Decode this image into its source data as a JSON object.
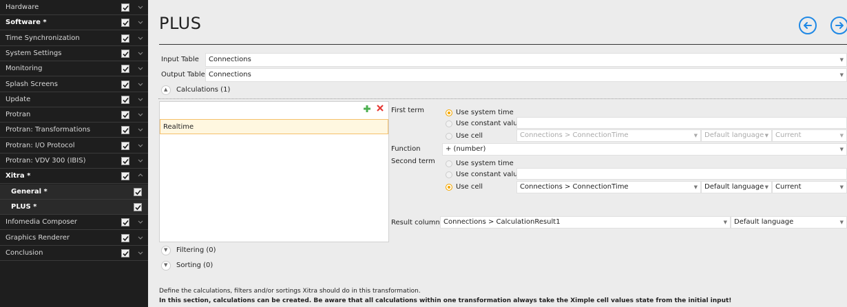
{
  "sidebar": {
    "items": [
      {
        "label": "Hardware",
        "checked": true
      },
      {
        "label": "Software *",
        "checked": true
      },
      {
        "label": "Time Synchronization",
        "checked": true
      },
      {
        "label": "System Settings",
        "checked": true
      },
      {
        "label": "Monitoring",
        "checked": true
      },
      {
        "label": "Splash Screens",
        "checked": true
      },
      {
        "label": "Update",
        "checked": true
      },
      {
        "label": "Protran",
        "checked": true
      },
      {
        "label": "Protran: Transformations",
        "checked": true
      },
      {
        "label": "Protran: I/O Protocol",
        "checked": true
      },
      {
        "label": "Protran: VDV 300 (IBIS)",
        "checked": true
      },
      {
        "label": "Xitra *",
        "checked": true
      },
      {
        "label": "General *",
        "checked": true
      },
      {
        "label": "PLUS *",
        "checked": true
      },
      {
        "label": "Infomedia Composer",
        "checked": true
      },
      {
        "label": "Graphics Renderer",
        "checked": true
      },
      {
        "label": "Conclusion",
        "checked": true
      }
    ]
  },
  "header": {
    "title": "PLUS",
    "back_icon": "arrow-left-circle-icon",
    "forward_icon": "arrow-right-circle-icon",
    "accent_color": "#1e88e5"
  },
  "tables": {
    "input_label": "Input Table",
    "input_value": "Connections",
    "output_label": "Output Table",
    "output_value": "Connections"
  },
  "sections": {
    "calculations": "Calculations (1)",
    "filtering": "Filtering (0)",
    "sorting": "Sorting (0)"
  },
  "calc_list": {
    "items": [
      "Realtime"
    ],
    "add_icon": "plus-icon",
    "delete_icon": "x-icon"
  },
  "first_term": {
    "label": "First term",
    "opt_system": "Use system time",
    "opt_constant": "Use constant value",
    "opt_cell": "Use cell",
    "selected": "system",
    "cell_value": "Connections > ConnectionTime",
    "language": "Default language",
    "scope": "Current"
  },
  "function": {
    "label": "Function",
    "value": "+ (number)"
  },
  "second_term": {
    "label": "Second term",
    "opt_system": "Use system time",
    "opt_constant": "Use constant value",
    "opt_cell": "Use cell",
    "selected": "cell",
    "cell_value": "Connections > ConnectionTime",
    "language": "Default language",
    "scope": "Current"
  },
  "result": {
    "label": "Result column",
    "value": "Connections > CalculationResult1",
    "language": "Default language"
  },
  "help": {
    "line1": "Define the calculations, filters and/or sortings Xitra should do in this transformation.",
    "line2": "In this section, calculations can be created. Be aware that all calculations within one transformation always take the Ximple cell values state from the initial input!"
  },
  "colors": {
    "active": "#f5a800",
    "sidebar_bg": "#1e1e1e"
  }
}
